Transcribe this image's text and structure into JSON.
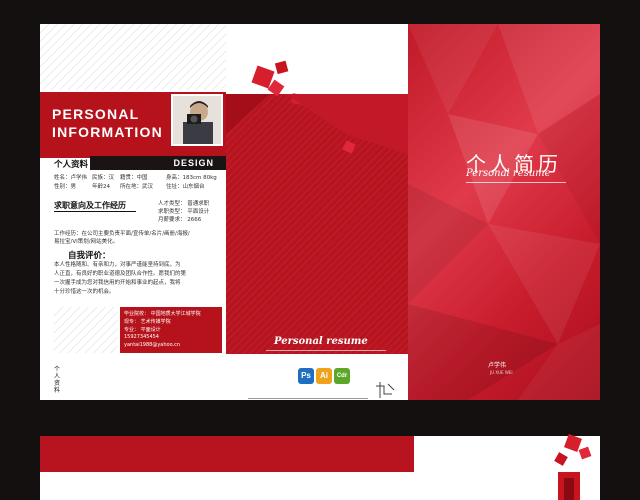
{
  "left_panel": {
    "banner_line1": "PERSONAL",
    "banner_line2": "INFORMATION",
    "personal_header": "个人资料",
    "design_label": "DESIGN",
    "info_rows": [
      [
        "姓名：卢学伟",
        "民族：汉",
        "籍贯：中国",
        "身高：183cm 80kg"
      ],
      [
        "性别：男",
        "年龄24",
        "所在地：武汉",
        "住址：山东烟台"
      ]
    ],
    "job_header": "求职意向及工作经历",
    "job_info": [
      "人才类型： 普通求职",
      "求职类型： 平面设计",
      "月薪要求： 2666"
    ],
    "work_experience": [
      "工作经历：在公司主要负责平面/宣传单/名片/画册/海报/",
      "易拉宝/VI策划/网站美化。"
    ],
    "self_eval_header": "自我评价：",
    "self_eval": [
      "本人性格随和、有亲和力，对事严谨能坚持到底，为",
      "人正直，有良好的职业道德及团队合作性。愿我们的第",
      "一次握手成为您对我信用的开始和事业的起点，我将",
      "十分珍惜这一次的机会。"
    ],
    "contact": [
      "毕业院校： 中国地质大学江城学院",
      "现专： 艺术传媒学院",
      "专业： 平面设计",
      "15927345454",
      "yantai1988@yahoo.cn"
    ],
    "vertical_label": "个人资料"
  },
  "middle_panel": {
    "title": "Personal resume",
    "software": [
      "Ps",
      "Ai",
      "Cdr"
    ]
  },
  "right_panel": {
    "title": "个人简历",
    "subtitle": "Personal resume",
    "name": "卢学伟",
    "name_en": "JU XUE WEI"
  },
  "colors": {
    "primary_red": "#b5121b",
    "dark": "#141010",
    "white": "#ffffff"
  }
}
